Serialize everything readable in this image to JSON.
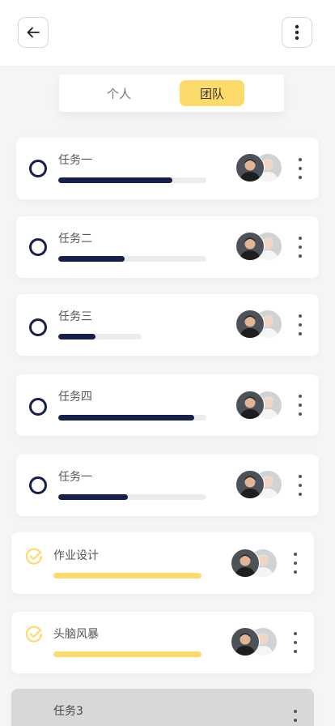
{
  "header": {
    "back_icon": "arrow-left-icon",
    "menu_icon": "vertical-dots-icon"
  },
  "tabs": [
    {
      "label": "个人",
      "selected": false
    },
    {
      "label": "团队",
      "selected": true
    }
  ],
  "colors": {
    "accent": "#fddb6a",
    "primary": "#16204a",
    "track": "#ececec",
    "background": "#f5f5f7"
  },
  "tasks": [
    {
      "title": "任务一",
      "status": "open",
      "progress": 0.77
    },
    {
      "title": "任务二",
      "status": "open",
      "progress": 0.45
    },
    {
      "title": "任务三",
      "status": "open",
      "progress": 0.45
    },
    {
      "title": "任务四",
      "status": "open",
      "progress": 0.92
    },
    {
      "title": "任务一",
      "status": "open",
      "progress": 0.47
    },
    {
      "title": "作业设计",
      "status": "done",
      "progress": 1.0
    },
    {
      "title": "头脑风暴",
      "status": "done",
      "progress": 1.0
    },
    {
      "title": "任务3",
      "status": "disabled",
      "progress": 0
    }
  ]
}
